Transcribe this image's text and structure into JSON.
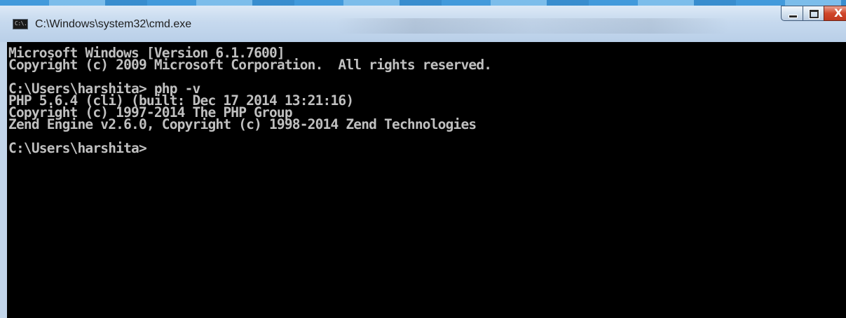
{
  "window": {
    "title": "C:\\Windows\\system32\\cmd.exe",
    "icon": "console-icon",
    "icon_label": "C:\\.",
    "buttons": {
      "minimize": "minimize-icon",
      "maximize": "maximize-icon",
      "close": "close-icon",
      "close_glyph": "X"
    }
  },
  "console": {
    "background": "#000000",
    "foreground": "#c0c0c0",
    "lines": [
      "Microsoft Windows [Version 6.1.7600]",
      "Copyright (c) 2009 Microsoft Corporation.  All rights reserved.",
      "",
      "C:\\Users\\harshita> php -v",
      "PHP 5.6.4 (cli) (built: Dec 17 2014 13:21:16)",
      "Copyright (c) 1997-2014 The PHP Group",
      "Zend Engine v2.6.0, Copyright (c) 1998-2014 Zend Technologies",
      "",
      "C:\\Users\\harshita>"
    ]
  }
}
